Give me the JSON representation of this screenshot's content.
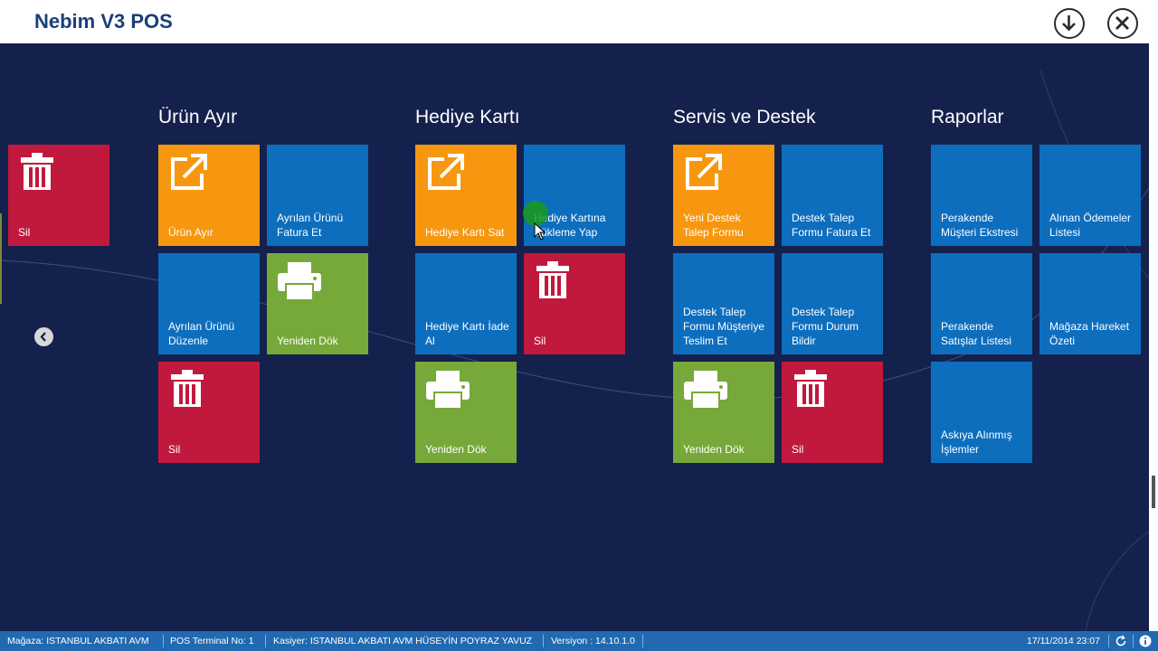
{
  "app": {
    "title": "Nebim V3 POS"
  },
  "titlebar": {
    "download_icon": "download-circle-icon",
    "close_icon": "close-circle-icon"
  },
  "colors": {
    "background": "#15214d",
    "orange": "#f7970f",
    "blue": "#0d6ebe",
    "red": "#c1193d",
    "green": "#77a83a",
    "statusbar": "#2169b0"
  },
  "offscreen_tile": {
    "label": "Sil",
    "icon": "trash-icon"
  },
  "groups": [
    {
      "title": "Ürün Ayır",
      "tiles": [
        {
          "label": "Ürün Ayır",
          "icon": "external-link-icon"
        },
        {
          "label": "Ayrılan Ürünü Fatura Et"
        },
        {
          "label": "Ayrılan Ürünü Düzenle"
        },
        {
          "label": "Yeniden Dök",
          "icon": "printer-icon"
        },
        {
          "label": "Sil",
          "icon": "trash-icon"
        }
      ]
    },
    {
      "title": "Hediye Kartı",
      "tiles": [
        {
          "label": "Hediye Kartı Sat",
          "icon": "external-link-icon"
        },
        {
          "label": "Hediye Kartına Yükleme Yap"
        },
        {
          "label": "Hediye Kartı İade Al"
        },
        {
          "label": "Sil",
          "icon": "trash-icon"
        },
        {
          "label": "Yeniden Dök",
          "icon": "printer-icon"
        }
      ]
    },
    {
      "title": "Servis ve Destek",
      "tiles": [
        {
          "label": "Yeni Destek Talep Formu",
          "icon": "external-link-icon"
        },
        {
          "label": "Destek Talep Formu Fatura Et"
        },
        {
          "label": "Destek Talep Formu Müşteriye Teslim Et"
        },
        {
          "label": "Destek Talep Formu Durum Bildir"
        },
        {
          "label": "Yeniden Dök",
          "icon": "printer-icon"
        },
        {
          "label": "Sil",
          "icon": "trash-icon"
        }
      ]
    },
    {
      "title": "Raporlar",
      "tiles": [
        {
          "label": "Perakende Müşteri Ekstresi"
        },
        {
          "label": "Alınan Ödemeler Listesi"
        },
        {
          "label": "Perakende Satışlar Listesi"
        },
        {
          "label": "Mağaza Hareket Özeti"
        },
        {
          "label": "Askıya Alınmış İşlemler"
        }
      ]
    }
  ],
  "statusbar": {
    "magaza": "Mağaza: ISTANBUL AKBATI AVM",
    "terminal": "POS Terminal No: 1",
    "kasiyer": "Kasiyer: ISTANBUL AKBATI AVM HÜSEYİN POYRAZ YAVUZ",
    "versiyon": "Versiyon : 14.10.1.0",
    "datetime": "17/11/2014 23:07",
    "refresh_icon": "refresh-icon",
    "info_icon": "info-icon"
  }
}
